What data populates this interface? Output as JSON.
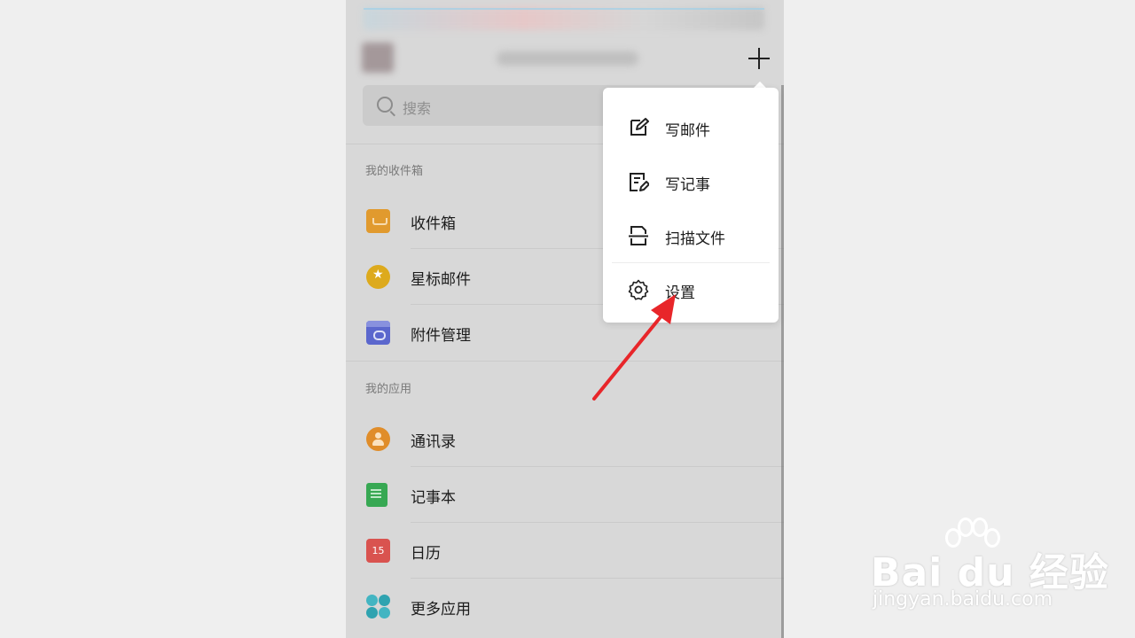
{
  "header": {
    "account_name_obscured": "",
    "add_icon": "plus-icon"
  },
  "search": {
    "placeholder": "搜索"
  },
  "sections": {
    "mailbox_title": "我的收件箱",
    "apps_title": "我的应用"
  },
  "mailbox_items": [
    {
      "label": "收件箱",
      "icon": "inbox-icon",
      "color": "#e19a2e"
    },
    {
      "label": "星标邮件",
      "icon": "star-icon",
      "color": "#ddaa1d"
    },
    {
      "label": "附件管理",
      "icon": "attachment-icon",
      "color": "#5b67cd"
    }
  ],
  "app_items": [
    {
      "label": "通讯录",
      "icon": "contacts-icon",
      "color": "#e08d2a"
    },
    {
      "label": "记事本",
      "icon": "notebook-icon",
      "color": "#37a853"
    },
    {
      "label": "日历",
      "icon": "calendar-icon",
      "color": "#d9534f",
      "badge": "15"
    },
    {
      "label": "更多应用",
      "icon": "more-apps-icon",
      "color": "#2fa3b0"
    }
  ],
  "menu": {
    "items": [
      {
        "label": "写邮件",
        "icon": "compose-icon"
      },
      {
        "label": "写记事",
        "icon": "note-edit-icon"
      },
      {
        "label": "扫描文件",
        "icon": "scan-icon"
      },
      {
        "label": "设置",
        "icon": "gear-icon"
      }
    ]
  },
  "annotation": {
    "arrow_color": "#e8262a"
  },
  "watermark": {
    "main": "Bai du 经验",
    "sub": "jingyan.baidu.com"
  }
}
